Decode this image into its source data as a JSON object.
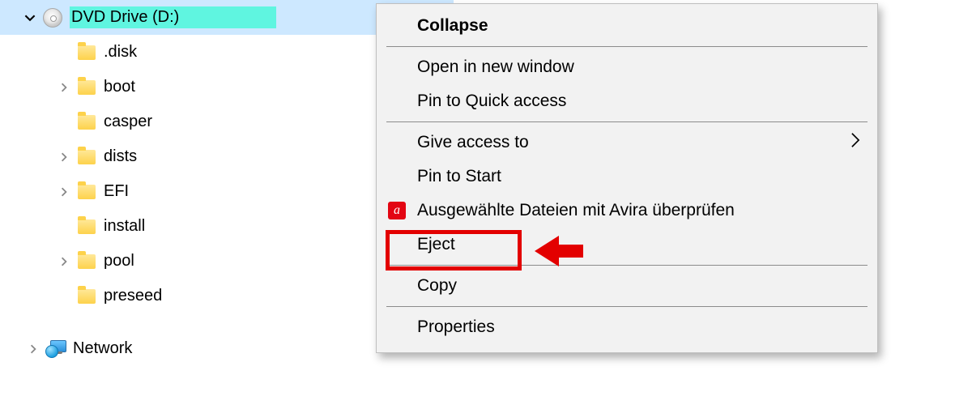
{
  "tree": {
    "drive": {
      "label": "DVD Drive (D:)",
      "expanded": true
    },
    "children": [
      {
        "label": ".disk",
        "expandable": false
      },
      {
        "label": "boot",
        "expandable": true
      },
      {
        "label": "casper",
        "expandable": false
      },
      {
        "label": "dists",
        "expandable": true
      },
      {
        "label": "EFI",
        "expandable": true
      },
      {
        "label": "install",
        "expandable": false
      },
      {
        "label": "pool",
        "expandable": true
      },
      {
        "label": "preseed",
        "expandable": false
      }
    ],
    "network": {
      "label": "Network",
      "expandable": true
    }
  },
  "menu": {
    "collapse": "Collapse",
    "open_new_window": "Open in new window",
    "pin_quick_access": "Pin to Quick access",
    "give_access_to": "Give access to",
    "pin_to_start": "Pin to Start",
    "avira_scan": "Ausgewählte Dateien mit Avira überprüfen",
    "eject": "Eject",
    "copy": "Copy",
    "properties": "Properties"
  },
  "icons": {
    "avira_glyph": "a"
  },
  "annotation": {
    "highlight_item": "eject"
  }
}
